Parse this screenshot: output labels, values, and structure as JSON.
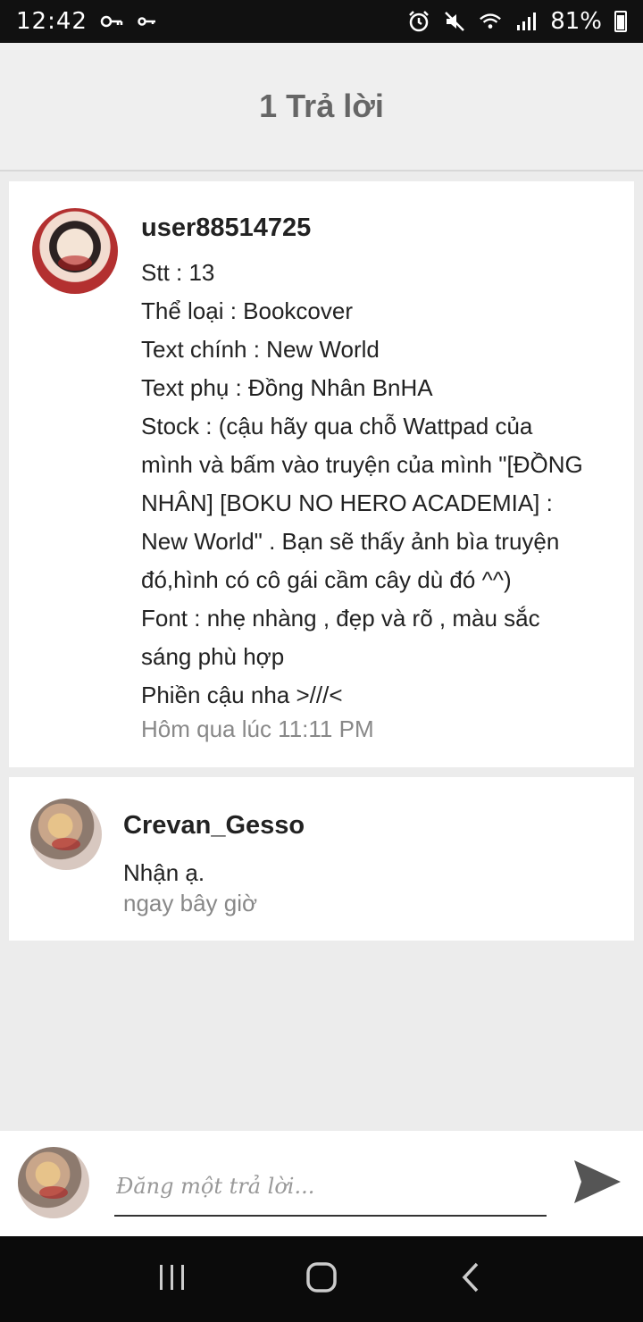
{
  "status_bar": {
    "time": "12:42",
    "battery_text": "81%",
    "battery_level": 0.81,
    "icons": [
      "key-icon",
      "vpn-key-icon",
      "alarm-icon",
      "mute-icon",
      "wifi-icon",
      "signal-icon",
      "battery-icon"
    ]
  },
  "header": {
    "title": "1 Trả lời"
  },
  "comments": [
    {
      "username": "user88514725",
      "lines": [
        "Stt : 13",
        "Thể loại : Bookcover",
        "Text chính : New World",
        "Text phụ : Đồng Nhân BnHA",
        "Stock : (cậu hãy qua chỗ Wattpad của",
        "mình và bấm vào truyện của mình \"[ĐỒNG",
        "NHÂN] [BOKU NO HERO ACADEMIA] :",
        "New World\" . Bạn sẽ thấy ảnh bìa truyện",
        "đó,hình có cô gái cầm cây dù đó ^^)",
        "Font : nhẹ nhàng , đẹp và rõ , màu sắc",
        "sáng phù hợp",
        "Phiền cậu nha >///<"
      ],
      "timestamp": "Hôm qua lúc 11:11 PM"
    },
    {
      "username": "Crevan_Gesso",
      "text": "Nhận ạ.",
      "timestamp": "ngay bây giờ"
    }
  ],
  "reply": {
    "placeholder": "Đăng một trả lời..."
  },
  "nav": {
    "icons": [
      "recent-apps-icon",
      "home-icon",
      "back-icon"
    ]
  },
  "colors": {
    "background": "#ececec",
    "header_text": "#666666",
    "timestamp": "#888888",
    "status_bar": "#111111"
  }
}
